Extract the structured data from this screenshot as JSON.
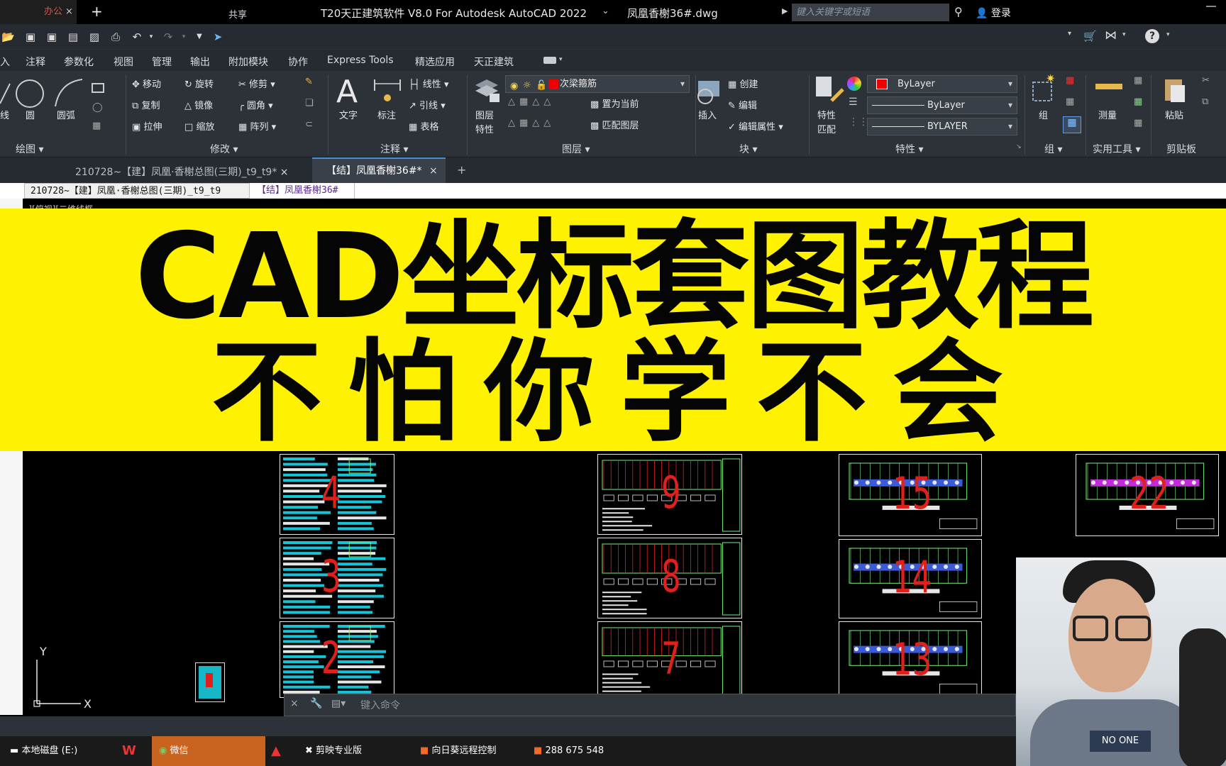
{
  "browser": {
    "tab_label": "办公",
    "close": "×",
    "new_tab": "+"
  },
  "titlebar": {
    "share": "共享",
    "title": "T20天正建筑软件 V8.0 For Autodesk AutoCAD 2022",
    "filename": "凤凰香榭36#.dwg",
    "search_placeholder": "键入关键字或短语",
    "login": "登录"
  },
  "menu": [
    "入",
    "注释",
    "参数化",
    "视图",
    "管理",
    "输出",
    "附加模块",
    "协作",
    "Express Tools",
    "精选应用",
    "天正建筑"
  ],
  "ribbon": {
    "draw": {
      "line": "线",
      "circle": "圆",
      "arc": "圆弧",
      "label": "绘图 ▾"
    },
    "modify": {
      "move": "移动",
      "rotate": "旋转",
      "trim": "修剪",
      "copy": "复制",
      "mirror": "镜像",
      "fillet": "圆角",
      "stretch": "拉伸",
      "scale": "缩放",
      "array": "阵列",
      "label": "修改 ▾"
    },
    "annotate": {
      "text": "文字",
      "dim": "标注",
      "linear": "线性",
      "leader": "引线",
      "table": "表格",
      "label": "注释 ▾"
    },
    "layers": {
      "props_1": "图层",
      "props_2": "特性",
      "current_layer": "次梁箍筋",
      "set_current": "置为当前",
      "match": "匹配图层",
      "label": "图层 ▾"
    },
    "block": {
      "insert": "插入",
      "create": "创建",
      "edit": "编辑",
      "edit_attr": "编辑属性",
      "label": "块 ▾"
    },
    "properties": {
      "match_1": "特性",
      "match_2": "匹配",
      "color": "ByLayer",
      "linetype": "ByLayer",
      "lineweight": "BYLAYER",
      "label": "特性 ▾"
    },
    "group": {
      "name": "组",
      "label": "组 ▾"
    },
    "utilities": {
      "measure": "测量",
      "label": "实用工具 ▾"
    },
    "clipboard": {
      "paste": "粘贴",
      "label": "剪贴板"
    }
  },
  "doctabs": {
    "tab1": "210728~【建】凤凰·香榭总图(三期)_t9_t9*",
    "tab2": "【结】凤凰香榭36#*",
    "close": "×",
    "add": "+"
  },
  "subtabs": {
    "tab1": "210728~【建】凤凰·香榭总图(三期)_t9_t9",
    "tab2": "【结】凤凰香榭36#"
  },
  "viewport_label": "-][俯视][二维线框",
  "banner": {
    "line1": "CAD坐标套图教程",
    "line2": "不怕你学不会"
  },
  "sheets": [
    {
      "num": "4"
    },
    {
      "num": "3"
    },
    {
      "num": "2"
    },
    {
      "num": "9"
    },
    {
      "num": "8"
    },
    {
      "num": "7"
    },
    {
      "num": "15"
    },
    {
      "num": "14"
    },
    {
      "num": "13"
    },
    {
      "num": "22"
    }
  ],
  "ucs": {
    "y": "Y",
    "x": "X"
  },
  "command": {
    "placeholder": "键入命令"
  },
  "taskbar": {
    "disk": "本地磁盘 (E:)",
    "wechat": "微信",
    "jianying": "剪映专业版",
    "sunlogin": "向日葵远程控制",
    "id": "288 675 548"
  },
  "webcam": {
    "shirt_text": "NO ONE"
  },
  "colors": {
    "banner": "#fef200",
    "accent_red": "#e0201a",
    "ribbon_bg": "#2d3239"
  }
}
